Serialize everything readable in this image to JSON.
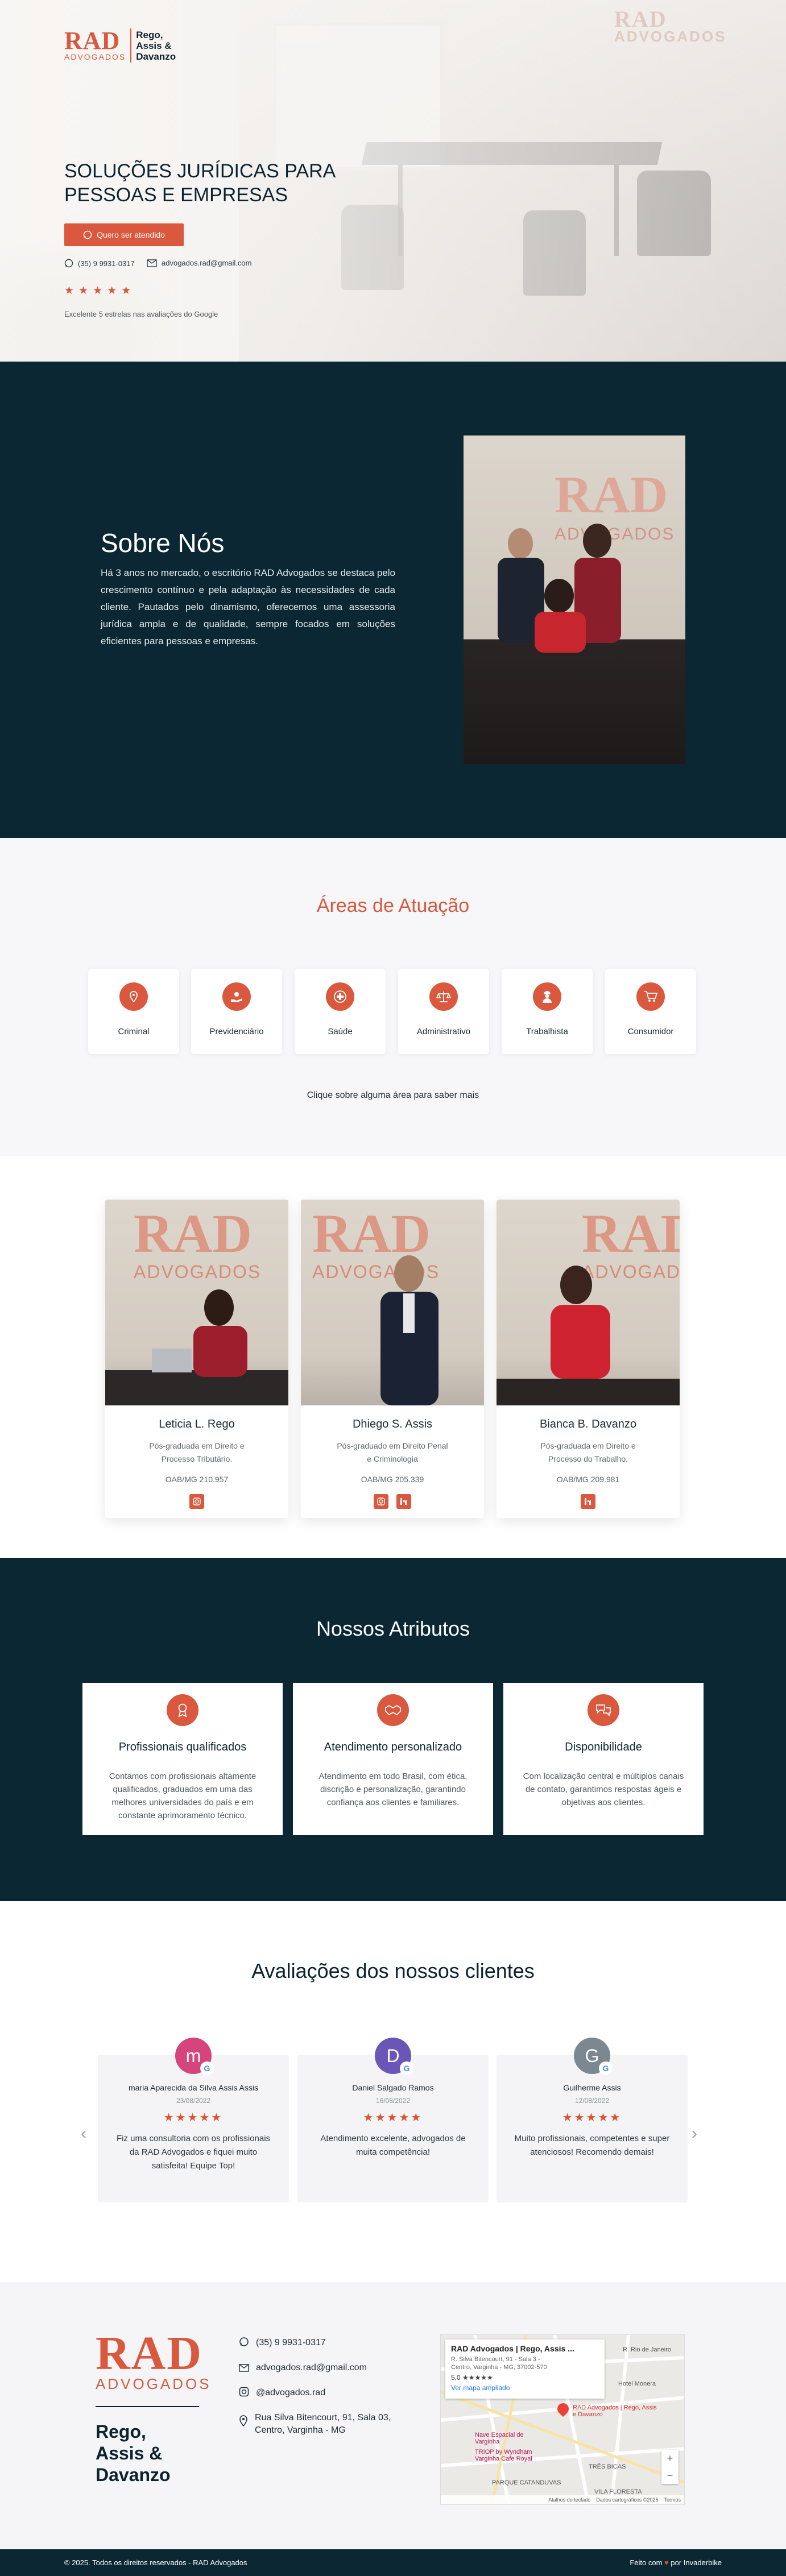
{
  "brand": {
    "mark": "RAD",
    "subtitle": "ADVOGADOS",
    "names": [
      "Rego,",
      "Assis &",
      "Davanzo"
    ]
  },
  "hero": {
    "headline_line1": "SOLUÇÕES JURÍDICAS PARA",
    "headline_line2": "PESSOAS E EMPRESAS",
    "cta_label": "Quero ser atendido",
    "phone": "(35) 9 9931-0317",
    "email": "advogados.rad@gmail.com",
    "stars": "★★★★★",
    "rating_text": "Excelente 5 estrelas nas avaliações do Google"
  },
  "about": {
    "title": "Sobre Nós",
    "text": "Há 3 anos no mercado, o escritório RAD Advogados se destaca pelo crescimento contínuo e pela adaptação às necessidades de cada cliente. Pautados pelo dinamismo, oferecemos uma assessoria jurídica ampla e de qualidade, sempre focados em soluções eficientes para pessoas e empresas."
  },
  "areas": {
    "title": "Áreas de Atuação",
    "items": [
      {
        "label": "Criminal",
        "icon": "map-pin-icon"
      },
      {
        "label": "Previdenciário",
        "icon": "hand-icon"
      },
      {
        "label": "Saúde",
        "icon": "medical-cross-icon"
      },
      {
        "label": "Administrativo",
        "icon": "scale-icon"
      },
      {
        "label": "Trabalhista",
        "icon": "worker-icon"
      },
      {
        "label": "Consumidor",
        "icon": "cart-icon"
      }
    ],
    "hint": "Clique sobre alguma área para saber mais"
  },
  "team": {
    "members": [
      {
        "name": "Leticia L. Rego",
        "desc": "Pós-graduada em Direito e Processo Tributário.",
        "oab": "OAB/MG 210.957"
      },
      {
        "name": "Dhiego S. Assis",
        "desc": "Pós-graduado em Direito Penal e Criminologia",
        "oab": "OAB/MG 205.339"
      },
      {
        "name": "Bianca B. Davanzo",
        "desc": "Pós-graduada em Direito e Processo do Trabalho.",
        "oab": "OAB/MG 209.981"
      }
    ]
  },
  "attributes": {
    "title": "Nossos Atributos",
    "items": [
      {
        "title": "Profissionais qualificados",
        "text": "Contamos com profissionais altamente qualificados, graduados em uma das melhores universidades do país e em constante aprimoramento técnico.",
        "icon": "award-icon"
      },
      {
        "title": "Atendimento personalizado",
        "text": "Atendimento em todo Brasil, com ética, discrição e personalização, garantindo confiança aos clientes e familiares.",
        "icon": "handshake-icon"
      },
      {
        "title": "Disponibilidade",
        "text": "Com localização central e múltiplos canais de contato, garantimos respostas ágeis e objetivas aos clientes.",
        "icon": "chat-icon"
      }
    ]
  },
  "reviews": {
    "title": "Avaliações dos nossos clientes",
    "items": [
      {
        "initial": "m",
        "color": "#d6447c",
        "name": "maria Aparecida da Silva Assis Assis",
        "date": "23/08/2022",
        "stars": "★★★★★",
        "text": "Fiz uma consultoria com os profissionais da RAD Advogados e fiquei muito satisfeita! Equipe Top!"
      },
      {
        "initial": "D",
        "color": "#6a56b6",
        "name": "Daniel Salgado Ramos",
        "date": "16/08/2022",
        "stars": "★★★★★",
        "text": "Atendimento excelente, advogados de muita competência!"
      },
      {
        "initial": "G",
        "color": "#7b8791",
        "name": "Guilherme Assis",
        "date": "12/08/2022",
        "stars": "★★★★★",
        "text": "Muito profissionais, competentes e super atenciosos! Recomendo demais!"
      }
    ]
  },
  "footer": {
    "phone": "(35) 9 9931-0317",
    "email": "advogados.rad@gmail.com",
    "instagram": "@advogados.rad",
    "address_line1": "Rua Silva Bitencourt, 91, Sala 03,",
    "address_line2": "Centro, Varginha - MG",
    "map": {
      "place": "RAD Advogados | Rego, Assis ...",
      "address_line1": "R. Silva Bitencourt, 91 - Sala 3 -",
      "address_line2": "Centro, Varginha - MG, 37002-570",
      "rating": "5,0 ★★★★★",
      "link": "Ver mapa ampliado",
      "labels": [
        "Nave Espacial de Varginha",
        "TRIOP by Wyndham Varginha Cafe Royal",
        "RAD Advogados | Rego, Assis e Davanzo",
        "Hotel Monera",
        "R. Rio de Janeiro",
        "TRÊS BICAS",
        "VILA FLORESTA",
        "PARQUE CATANDUVAS"
      ],
      "footer_items": [
        "Atalhos do teclado",
        "Dados cartográficos ©2025",
        "Termos"
      ]
    },
    "copyright": "© 2025. Todos os direitos reservados - RAD Advogados",
    "credit_pre": "Feito com",
    "credit_post": "por Invaderbike"
  }
}
